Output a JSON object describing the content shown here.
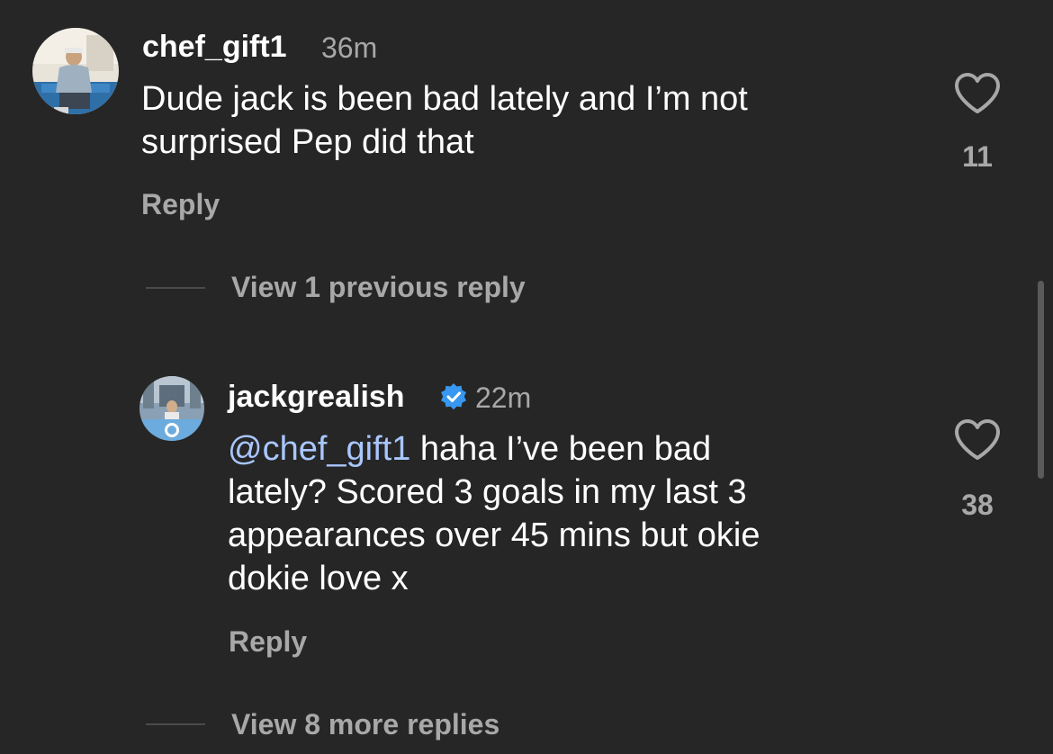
{
  "comments": [
    {
      "username": "chef_gift1",
      "time": "36m",
      "lines": [
        "Dude jack is been bad lately and I’m not",
        "surprised Pep did that"
      ],
      "reply_label": "Reply",
      "likes": "11"
    },
    {
      "username": "jackgrealish",
      "verified": true,
      "time": "22m",
      "mention": "@chef_gift1",
      "lines": [
        " haha I’ve been bad",
        "lately? Scored 3 goals in my last 3",
        "appearances over 45 mins but okie",
        "dokie love x"
      ],
      "reply_label": "Reply",
      "likes": "38"
    }
  ],
  "view_previous_label": "View 1 previous reply",
  "view_more_label": "View 8 more replies",
  "icons": {
    "like": "heart-outline-icon",
    "verified": "verified-badge-icon"
  },
  "colors": {
    "background": "#262626",
    "primary_text": "#ffffff",
    "secondary_text": "#a8a8a8",
    "mention": "#a9c7ff",
    "verified": "#3897f0"
  }
}
